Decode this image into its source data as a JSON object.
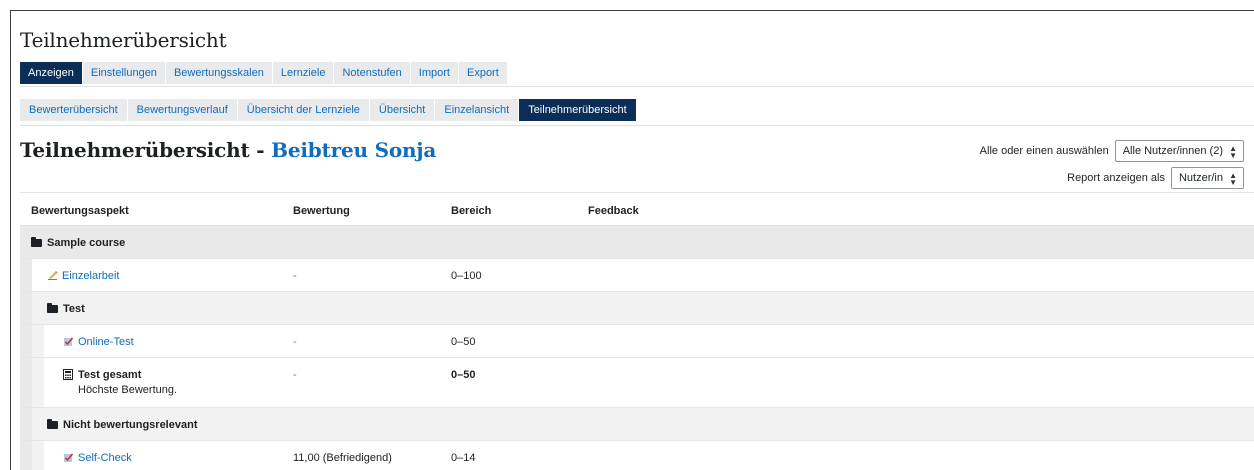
{
  "page": {
    "title": "Teilnehmerübersicht"
  },
  "tabs_main": [
    {
      "label": "Anzeigen",
      "active": true
    },
    {
      "label": "Einstellungen",
      "active": false
    },
    {
      "label": "Bewertungsskalen",
      "active": false
    },
    {
      "label": "Lernziele",
      "active": false
    },
    {
      "label": "Notenstufen",
      "active": false
    },
    {
      "label": "Import",
      "active": false
    },
    {
      "label": "Export",
      "active": false
    }
  ],
  "tabs_sub": [
    {
      "label": "Bewerterübersicht",
      "active": false
    },
    {
      "label": "Bewertungsverlauf",
      "active": false
    },
    {
      "label": "Übersicht der Lernziele",
      "active": false
    },
    {
      "label": "Übersicht",
      "active": false
    },
    {
      "label": "Einzelansicht",
      "active": false
    },
    {
      "label": "Teilnehmerübersicht",
      "active": true
    }
  ],
  "report": {
    "heading_prefix": "Teilnehmerübersicht - ",
    "user_name": "Beibtreu Sonja",
    "select_user_label": "Alle oder einen auswählen",
    "select_user_value": "Alle Nutzer/innen (2)",
    "view_as_label": "Report anzeigen als",
    "view_as_value": "Nutzer/in"
  },
  "table": {
    "headers": {
      "item": "Bewertungsaspekt",
      "grade": "Bewertung",
      "range": "Bereich",
      "feedback": "Feedback"
    },
    "rows": {
      "course": {
        "name": "Sample course"
      },
      "einzelarbeit": {
        "name": "Einzelarbeit",
        "grade": "-",
        "range": "0–100",
        "icon": "assignment-icon"
      },
      "test_cat": {
        "name": "Test"
      },
      "online_test": {
        "name": "Online-Test",
        "grade": "-",
        "range": "0–50",
        "icon": "quiz-icon"
      },
      "test_total": {
        "name": "Test gesamt",
        "sub": "Höchste Bewertung.",
        "grade": "-",
        "range": "0–50",
        "icon": "calculator-icon"
      },
      "nicht_cat": {
        "name": "Nicht bewertungsrelevant"
      },
      "self_check": {
        "name": "Self-Check",
        "grade": "11,00 (Befriedigend)",
        "range": "0–14",
        "icon": "quiz-icon"
      }
    }
  },
  "colors": {
    "active_tab": "#0b2e59",
    "link": "#0f6cbf",
    "tab_bg": "#e9eaec",
    "category_bg": "#e9e9e9"
  }
}
